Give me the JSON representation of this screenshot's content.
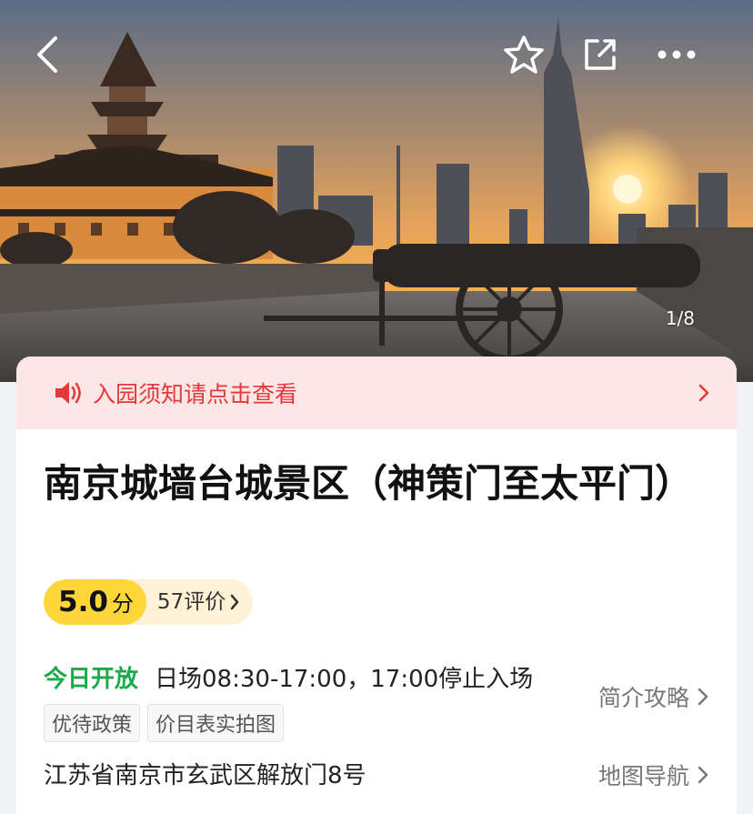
{
  "header": {
    "image_counter": "1/8",
    "icons": [
      "back-arrow-icon",
      "star-icon",
      "share-icon",
      "more-icon"
    ]
  },
  "notice": {
    "text": "入园须知请点击查看",
    "icon": "speaker-icon",
    "color": "#e5383b"
  },
  "attraction": {
    "title": "南京城墙台城景区（神策门至太平门）"
  },
  "rating": {
    "score": "5.0",
    "unit": "分",
    "reviews": "57评价"
  },
  "hours": {
    "status": "今日开放",
    "text": "日场08:30-17:00，17:00停止入场"
  },
  "tags": [
    "优待政策",
    "价目表实拍图"
  ],
  "links": {
    "intro": "简介攻略",
    "map": "地图导航"
  },
  "address": "江苏省南京市玄武区解放门8号",
  "colors": {
    "accent_green": "#1ba94c",
    "rating_yellow": "#ffd63a",
    "notice_bg": "#fde6e6"
  }
}
